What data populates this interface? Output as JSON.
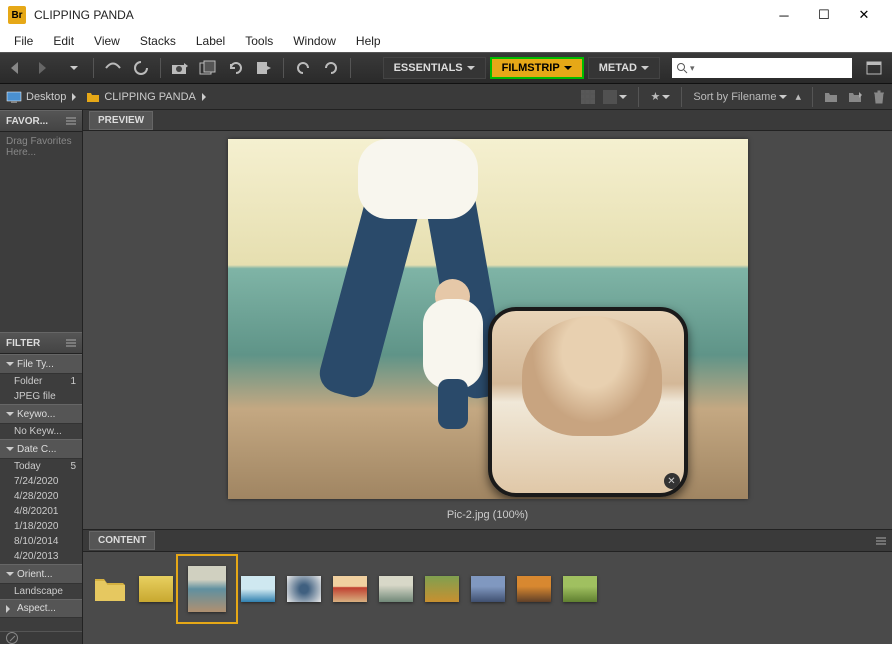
{
  "window": {
    "title": "CLIPPING PANDA",
    "logo": "Br"
  },
  "menu": [
    "File",
    "Edit",
    "View",
    "Stacks",
    "Label",
    "Tools",
    "Window",
    "Help"
  ],
  "workspaces": {
    "essentials": "ESSENTIALS",
    "filmstrip": "FILMSTRIP",
    "metadata": "METAD"
  },
  "breadcrumb": {
    "root": "Desktop",
    "folder": "CLIPPING PANDA"
  },
  "sort": {
    "label": "Sort by Filename"
  },
  "panels": {
    "favorites": {
      "title": "FAVOR...",
      "placeholder": "Drag Favorites Here..."
    },
    "filter": {
      "title": "FILTER",
      "cats": {
        "filetype": {
          "label": "File Ty...",
          "items": [
            {
              "k": "Folder",
              "v": "1"
            },
            {
              "k": "JPEG file",
              "v": ""
            }
          ]
        },
        "keywords": {
          "label": "Keywo...",
          "items": [
            {
              "k": "No Keyw...",
              "v": ""
            }
          ]
        },
        "datec": {
          "label": "Date C...",
          "items": [
            {
              "k": "Today",
              "v": "5"
            },
            {
              "k": "7/24/2020",
              "v": ""
            },
            {
              "k": "4/28/2020",
              "v": ""
            },
            {
              "k": "4/8/20201",
              "v": ""
            },
            {
              "k": "1/18/2020",
              "v": ""
            },
            {
              "k": "8/10/2014",
              "v": ""
            },
            {
              "k": "4/20/2013",
              "v": ""
            }
          ]
        },
        "orient": {
          "label": "Orient...",
          "items": [
            {
              "k": "Landscape",
              "v": ""
            }
          ]
        },
        "aspect": {
          "label": "Aspect...",
          "items": []
        }
      }
    },
    "preview": {
      "title": "PREVIEW",
      "caption": "Pic-2.jpg (100%)"
    },
    "content": {
      "title": "CONTENT"
    }
  },
  "thumbs": [
    {
      "name": "folder",
      "bg": ""
    },
    {
      "name": "pic1",
      "bg": "linear-gradient(#e8d060,#c8a830)"
    },
    {
      "name": "pic2-selected",
      "bg": ""
    },
    {
      "name": "pic3",
      "bg": "linear-gradient(#cfe8f0 50%,#3080b0)"
    },
    {
      "name": "pic4",
      "bg": "radial-gradient(circle,#406080 20%,#e8e8e8)"
    },
    {
      "name": "pic5",
      "bg": "linear-gradient(#f0d0a0 40%,#c04030 45%,#d8b080)"
    },
    {
      "name": "pic6",
      "bg": "linear-gradient(#d8d8c8 35%,#708878)"
    },
    {
      "name": "pic7",
      "bg": "linear-gradient(#80a050,#c89030)"
    },
    {
      "name": "pic8",
      "bg": "linear-gradient(#8098c0 40%,#405070)"
    },
    {
      "name": "pic9",
      "bg": "linear-gradient(#d88830 40%,#604028)"
    },
    {
      "name": "pic10",
      "bg": "linear-gradient(#a0c060 40%,#608030)"
    }
  ]
}
